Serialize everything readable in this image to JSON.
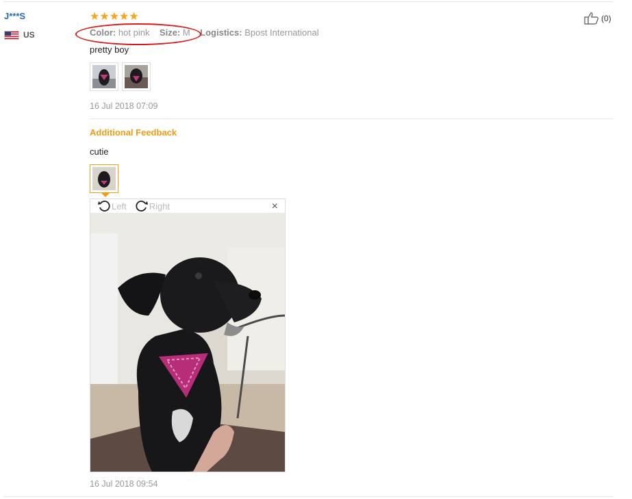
{
  "review": {
    "username": "J***S",
    "country_code": "US",
    "stars": "★★★★★",
    "attributes": {
      "color_label": "Color:",
      "color_value": "hot pink",
      "size_label": "Size:",
      "size_value": "M",
      "logistics_label": "Logistics:",
      "logistics_value": "Bpost International"
    },
    "helpful_count": "(0)",
    "text": "pretty boy",
    "date": "16 Jul 2018 07:09"
  },
  "additional": {
    "heading": "Additional Feedback",
    "text": "cutie",
    "date": "16 Jul 2018 09:54"
  },
  "viewer": {
    "rotate_left": "Left",
    "rotate_right": "Right",
    "close": "×"
  },
  "colors": {
    "username": "#2b6bb5",
    "stars": "#f7a31b",
    "accent_orange": "#f39c12",
    "annotation_red": "#d91a1a"
  }
}
